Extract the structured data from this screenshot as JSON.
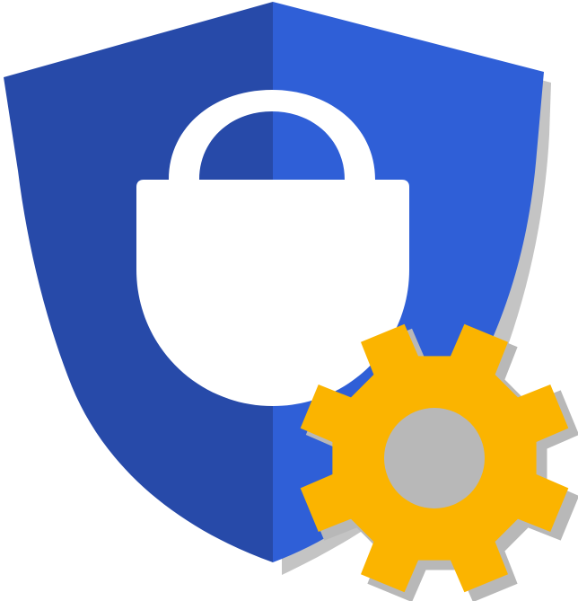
{
  "icon": {
    "name": "security-settings-icon",
    "parts": [
      "shield-icon",
      "lock-icon",
      "gear-icon"
    ]
  },
  "colors": {
    "shield_left": "#274aa9",
    "shield_right": "#2f5fd7",
    "shadow": "#c4c4c4",
    "lock": "#ffffff",
    "gear": "#fbb400",
    "gear_shadow": "#b8b8b8",
    "background": "#ffffff"
  }
}
